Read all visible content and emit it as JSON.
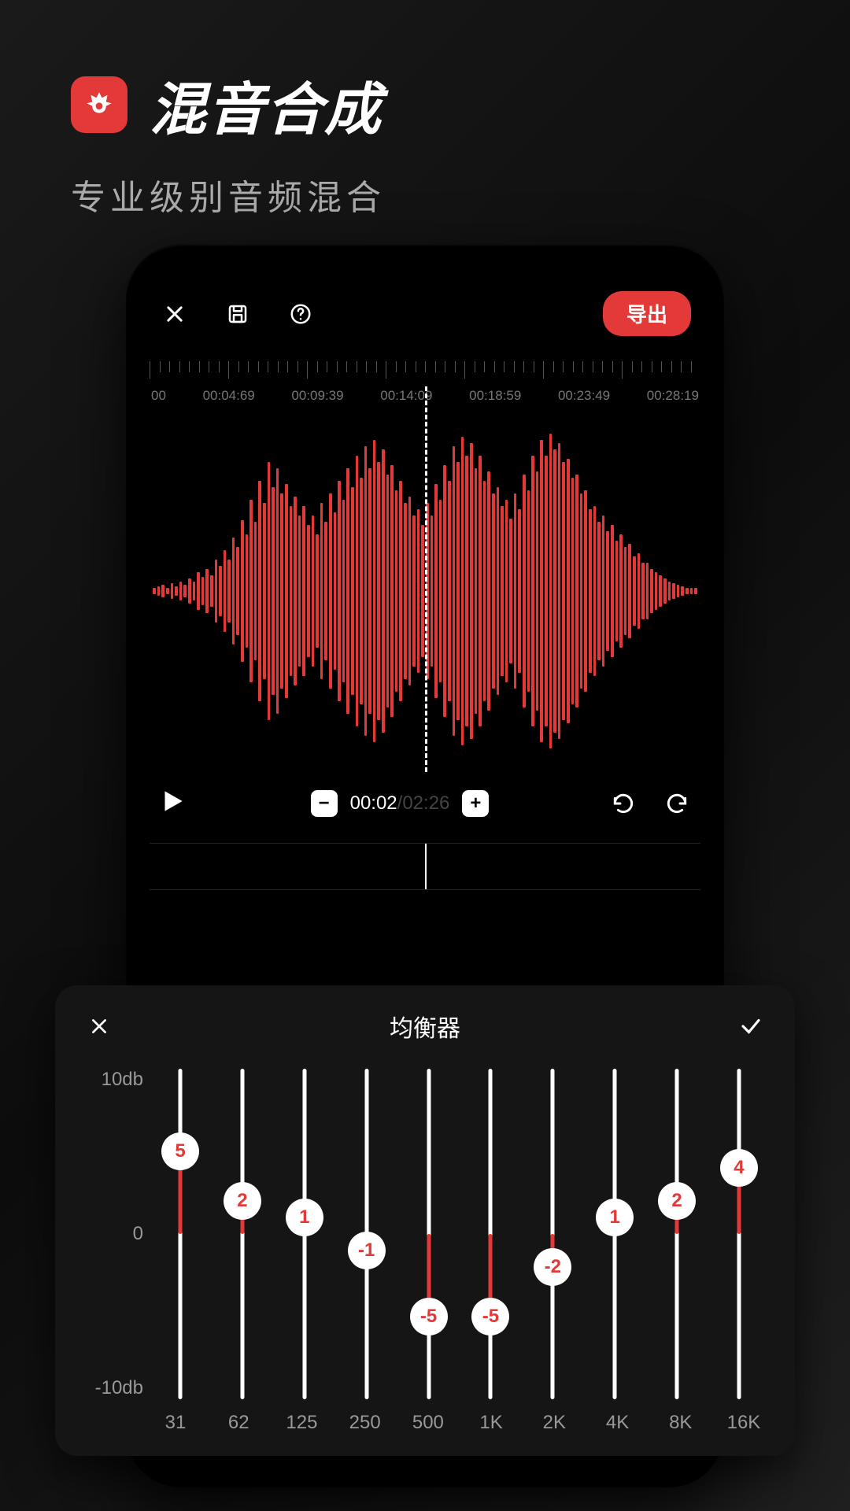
{
  "header": {
    "title": "混音合成",
    "subtitle": "专业级别音频混合"
  },
  "toolbar": {
    "export_label": "导出"
  },
  "timeline": {
    "markers": [
      "00",
      "00:04:69",
      "00:09:39",
      "00:14:09",
      "00:18:59",
      "00:23:49",
      "00:28:19"
    ]
  },
  "playback": {
    "current": "00:02",
    "total": "02:26"
  },
  "equalizer": {
    "title": "均衡器",
    "y_top": "10db",
    "y_mid": "0",
    "y_bot": "-10db",
    "bands": [
      {
        "freq": "31",
        "value": 5
      },
      {
        "freq": "62",
        "value": 2
      },
      {
        "freq": "125",
        "value": 1
      },
      {
        "freq": "250",
        "value": -1
      },
      {
        "freq": "500",
        "value": -5
      },
      {
        "freq": "1K",
        "value": -5
      },
      {
        "freq": "2K",
        "value": -2
      },
      {
        "freq": "4K",
        "value": 1
      },
      {
        "freq": "8K",
        "value": 2
      },
      {
        "freq": "16K",
        "value": 4
      }
    ]
  },
  "waveform_samples": [
    2,
    3,
    4,
    2,
    5,
    3,
    6,
    4,
    8,
    6,
    12,
    9,
    14,
    10,
    20,
    16,
    26,
    20,
    34,
    28,
    45,
    36,
    58,
    44,
    70,
    56,
    82,
    66,
    78,
    62,
    68,
    54,
    60,
    48,
    54,
    42,
    48,
    36,
    56,
    44,
    62,
    50,
    70,
    58,
    78,
    66,
    86,
    72,
    92,
    78,
    96,
    82,
    90,
    74,
    80,
    64,
    70,
    56,
    60,
    48,
    52,
    42,
    56,
    48,
    68,
    58,
    80,
    70,
    92,
    82,
    98,
    86,
    94,
    78,
    86,
    70,
    76,
    62,
    66,
    54,
    58,
    46,
    62,
    52,
    74,
    64,
    86,
    76,
    96,
    86,
    100,
    90,
    94,
    82,
    84,
    72,
    74,
    62,
    64,
    52,
    54,
    44,
    48,
    38,
    42,
    32,
    36,
    28,
    30,
    22,
    24,
    18,
    18,
    14,
    12,
    10,
    8,
    6,
    5,
    4,
    3,
    2,
    2,
    2
  ]
}
